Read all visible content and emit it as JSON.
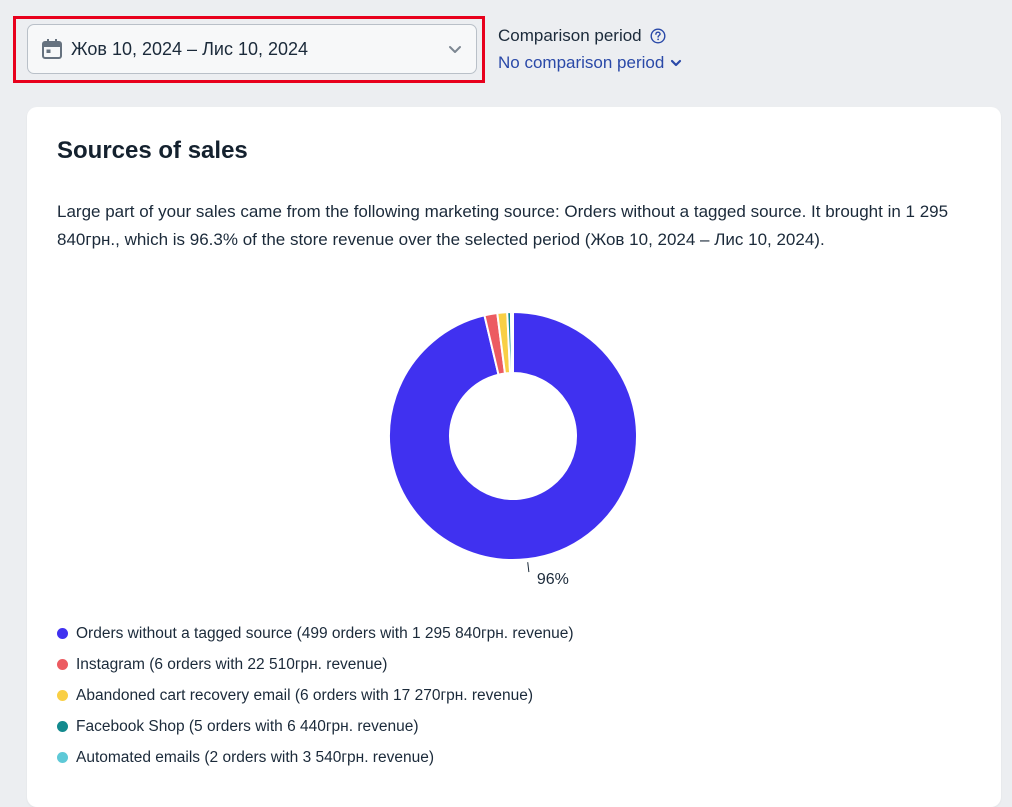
{
  "date_picker": {
    "value": "Жов 10, 2024 – Лис 10, 2024",
    "icon": "calendar-icon"
  },
  "comparison": {
    "label": "Comparison period",
    "value": "No comparison period",
    "help_icon": "question-circle-icon"
  },
  "card": {
    "title": "Sources of sales",
    "summary": "Large part of your sales came from the following marketing source: Orders without a tagged source. It brought in 1 295 840грн., which is 96.3% of the store revenue over the selected period (Жов 10, 2024 – Лис 10, 2024)."
  },
  "colors": {
    "highlight_border": "#e8001c",
    "link": "#2a49a8"
  },
  "chart_data": {
    "type": "pie",
    "donut": true,
    "categories": [
      "Orders without a tagged source (499 orders with 1 295 840грн. revenue)",
      "Instagram (6 orders with 22 510грн. revenue)",
      "Abandoned cart recovery email (6 orders with 17 270грн. revenue)",
      "Facebook Shop (5 orders with 6 440грн. revenue)",
      "Automated emails (2 orders with 3 540грн. revenue)"
    ],
    "values": [
      1295840,
      22510,
      17270,
      6440,
      3540
    ],
    "colors": [
      "#4031f0",
      "#ec5b61",
      "#f9cf45",
      "#138a8e",
      "#5ec9d7"
    ],
    "data_labels": [
      "96%"
    ],
    "legend_position": "bottom-left"
  }
}
